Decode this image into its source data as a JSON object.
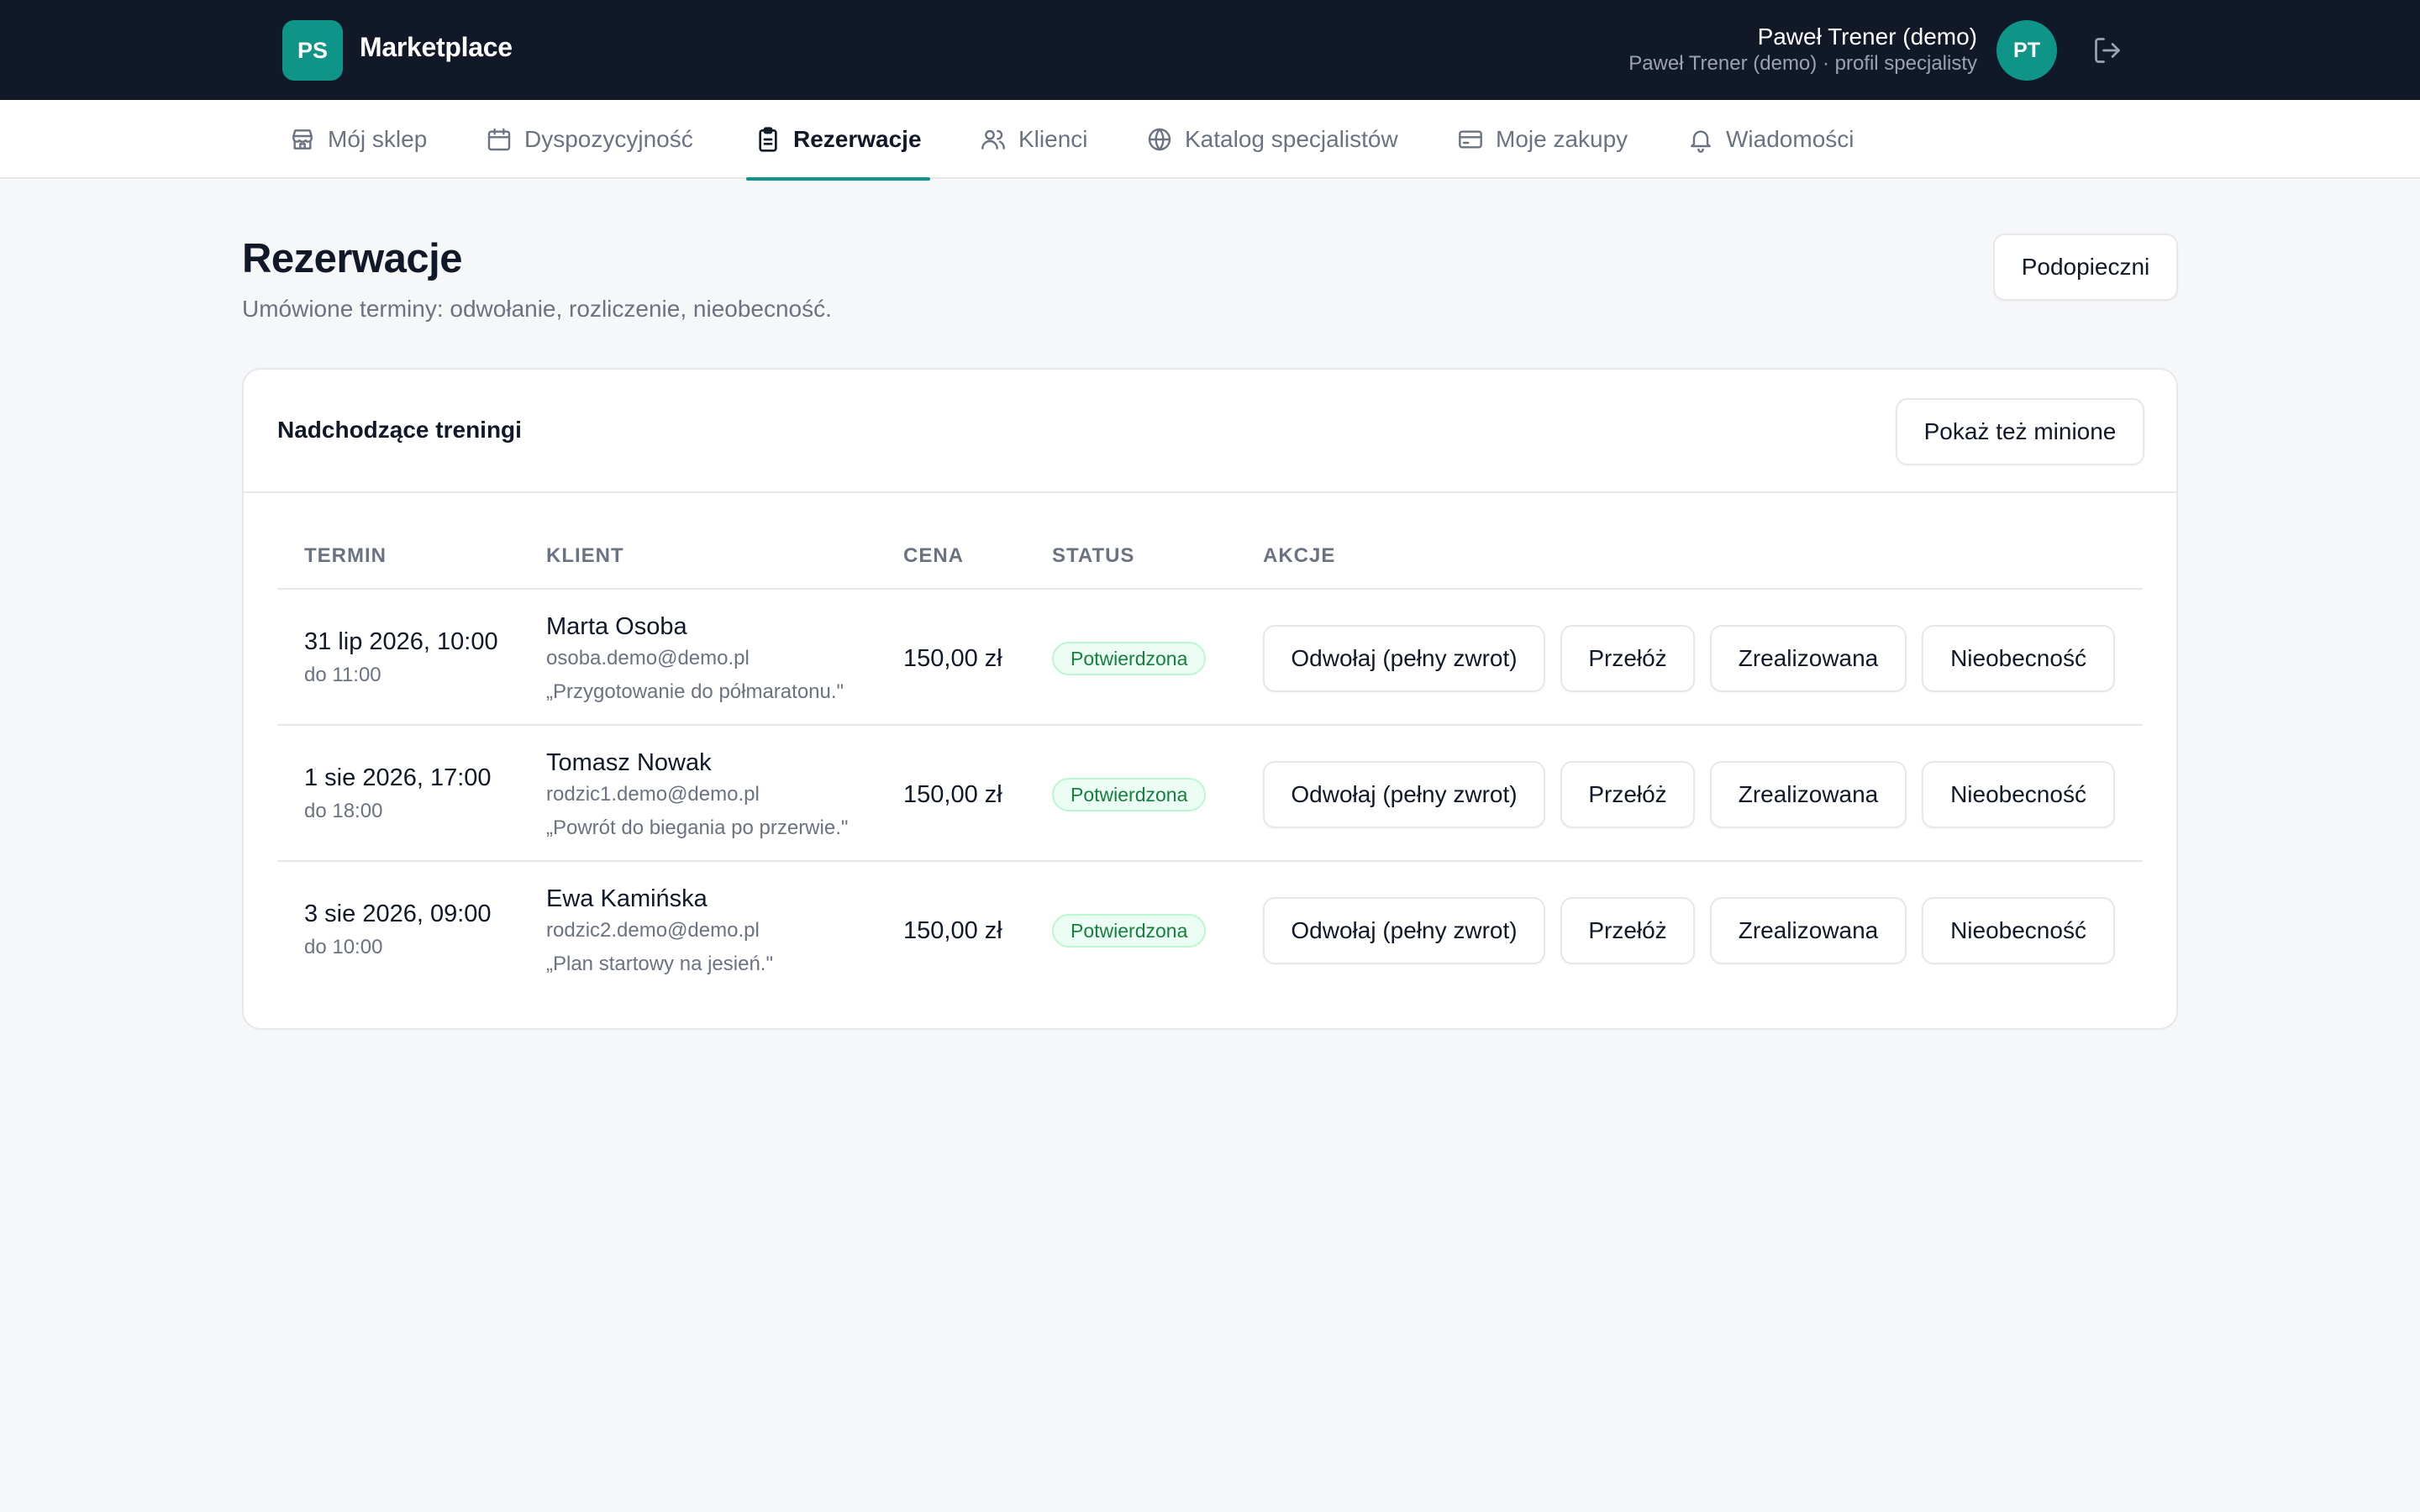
{
  "header": {
    "logo_initials": "PS",
    "brand": "Marketplace",
    "user_name": "Paweł Trener (demo)",
    "user_role": "Paweł Trener (demo) · profil specjalisty",
    "avatar_initials": "PT"
  },
  "nav": {
    "items": [
      {
        "label": "Mój sklep",
        "icon": "store-icon"
      },
      {
        "label": "Dyspozycyjność",
        "icon": "calendar-icon"
      },
      {
        "label": "Rezerwacje",
        "icon": "clipboard-icon",
        "active": true
      },
      {
        "label": "Klienci",
        "icon": "users-icon"
      },
      {
        "label": "Katalog specjalistów",
        "icon": "globe-icon"
      },
      {
        "label": "Moje zakupy",
        "icon": "credit-card-icon"
      },
      {
        "label": "Wiadomości",
        "icon": "bell-icon"
      }
    ]
  },
  "page": {
    "title": "Rezerwacje",
    "subtitle": "Umówione terminy: odwołanie, rozliczenie, nieobecność.",
    "wards_button": "Podopieczni"
  },
  "card": {
    "title": "Nadchodzące treningi",
    "show_past_button": "Pokaż też minione",
    "columns": [
      "TERMIN",
      "KLIENT",
      "CENA",
      "STATUS",
      "AKCJE"
    ],
    "rows": [
      {
        "date": "31 lip 2026, 10:00",
        "end": "do 11:00",
        "client": "Marta Osoba",
        "email": "osoba.demo@demo.pl",
        "note": "„Przygotowanie do półmaratonu.\"",
        "price": "150,00 zł",
        "status": "Potwierdzona"
      },
      {
        "date": "1 sie 2026, 17:00",
        "end": "do 18:00",
        "client": "Tomasz Nowak",
        "email": "rodzic1.demo@demo.pl",
        "note": "„Powrót do biegania po przerwie.\"",
        "price": "150,00 zł",
        "status": "Potwierdzona"
      },
      {
        "date": "3 sie 2026, 09:00",
        "end": "do 10:00",
        "client": "Ewa Kamińska",
        "email": "rodzic2.demo@demo.pl",
        "note": "„Plan startowy na jesień.\"",
        "price": "150,00 zł",
        "status": "Potwierdzona"
      }
    ],
    "actions": {
      "cancel": "Odwołaj (pełny zwrot)",
      "reschedule": "Przełóż",
      "done": "Zrealizowana",
      "no_show": "Nieobecność"
    }
  },
  "colors": {
    "accent": "#0f9488",
    "topbar": "#111827",
    "status_confirmed": "#15803d"
  }
}
